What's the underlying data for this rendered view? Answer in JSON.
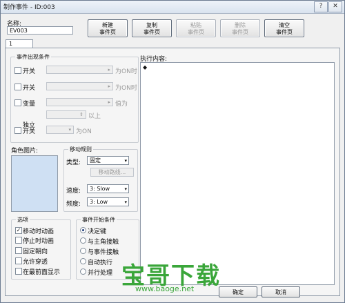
{
  "window": {
    "title": "制作事件 - ID:003",
    "help_label": "?",
    "close_label": "✕"
  },
  "name_label": "名称:",
  "name_value": "EV003",
  "toolbar": [
    {
      "line1": "新建",
      "line2": "事件页",
      "enabled": true
    },
    {
      "line1": "复制",
      "line2": "事件页",
      "enabled": true
    },
    {
      "line1": "粘贴",
      "line2": "事件页",
      "enabled": false
    },
    {
      "line1": "删除",
      "line2": "事件页",
      "enabled": false
    },
    {
      "line1": "清空",
      "line2": "事件页",
      "enabled": true
    }
  ],
  "page_tab": "1",
  "conditions": {
    "title": "事件出现条件",
    "switch1": "开关",
    "switch1_suffix": "为ON时",
    "switch2": "开关",
    "switch2_suffix": "为ON时",
    "variable": "变量",
    "variable_suffix": "值为",
    "above": "以上",
    "self_switch_1": "独立",
    "self_switch_2": "开关",
    "self_switch_suffix": "为ON"
  },
  "graphic_label": "角色图片:",
  "movement": {
    "title": "移动规则",
    "type_label": "类型:",
    "type_value": "固定",
    "route_button": "移动路线...",
    "speed_label": "速度:",
    "speed_value": "3: Slow",
    "freq_label": "频度:",
    "freq_value": "3: Low"
  },
  "options": {
    "title": "选项",
    "items": [
      {
        "label": "移动时动画",
        "checked": true
      },
      {
        "label": "停止时动画",
        "checked": false
      },
      {
        "label": "固定朝向",
        "checked": false
      },
      {
        "label": "允许穿透",
        "checked": false
      },
      {
        "label": "在最前面显示",
        "checked": false
      }
    ]
  },
  "trigger": {
    "title": "事件开始条件",
    "items": [
      {
        "label": "决定键",
        "selected": true
      },
      {
        "label": "与主角接触",
        "selected": false
      },
      {
        "label": "与事件接触",
        "selected": false
      },
      {
        "label": "自动执行",
        "selected": false
      },
      {
        "label": "并行处理",
        "selected": false
      }
    ]
  },
  "exec_label": "执行内容:",
  "exec_marker": "◆",
  "footer": {
    "ok": "确定",
    "cancel": "取消"
  },
  "watermark": {
    "text": "宝哥下载",
    "url": "www.baoge.net"
  }
}
